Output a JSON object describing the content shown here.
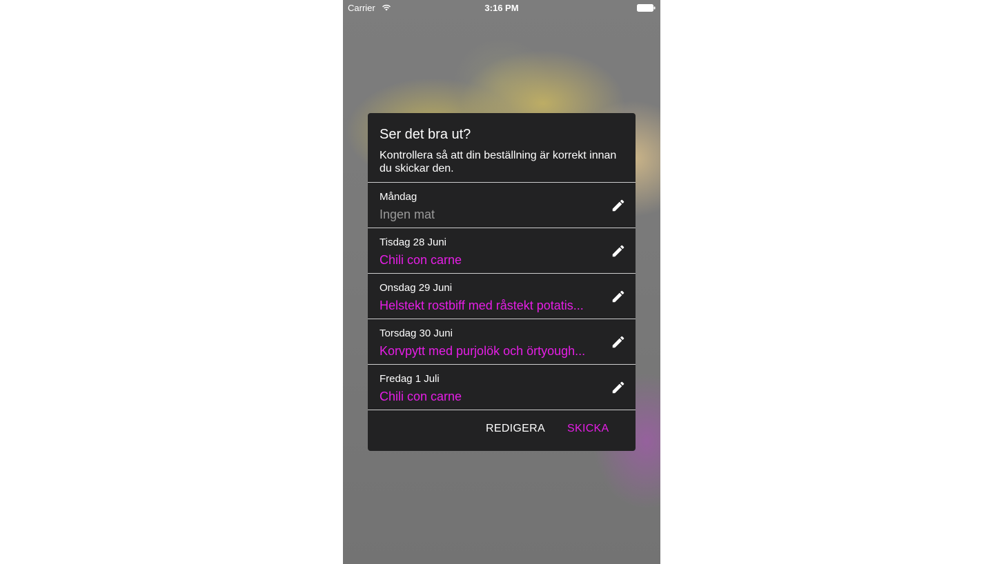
{
  "status_bar": {
    "carrier": "Carrier",
    "time": "3:16 PM"
  },
  "dialog": {
    "title": "Ser det bra ut?",
    "message": "Kontrollera så att din beställning är korrekt innan du skickar den.",
    "days": [
      {
        "day": "Måndag",
        "meal": "Ingen mat"
      },
      {
        "day": "Tisdag 28 Juni",
        "meal": "Chili con carne"
      },
      {
        "day": "Onsdag 29 Juni",
        "meal": "Helstekt rostbiff med råstekt potatis..."
      },
      {
        "day": "Torsdag 30 Juni",
        "meal": "Korvpytt med purjolök och örtyough..."
      },
      {
        "day": "Fredag 1 Juli",
        "meal": "Chili con carne"
      }
    ],
    "edit_icon": "pencil-icon",
    "buttons": {
      "edit": "REDIGERA",
      "send": "SKICKA"
    }
  },
  "colors": {
    "accent": "#e61ee6",
    "dialog_background": "#222223",
    "placeholder_meal": "#9a9a9a"
  }
}
